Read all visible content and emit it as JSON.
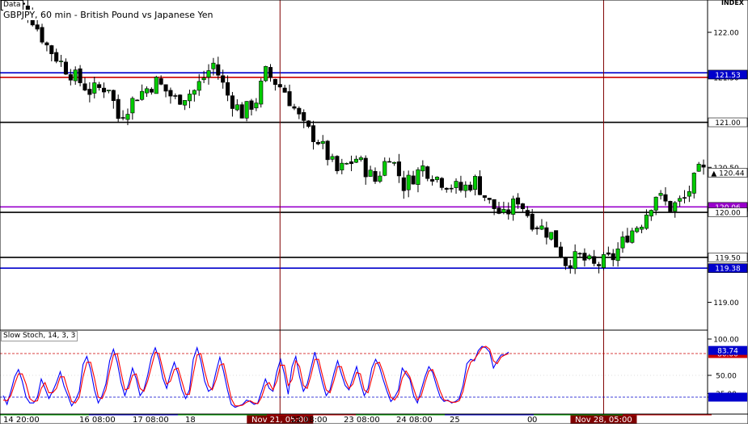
{
  "data_tag": "Data",
  "index_label": "INDEX",
  "chart_data": [
    {
      "type": "candlestick",
      "title": "GBPJPY, 60 min - British Pound vs Japanese Yen",
      "ylim": [
        118.7,
        122.35
      ],
      "y_ticks": [
        "122.00",
        "121.50",
        "121.00",
        "120.50",
        "120.00",
        "119.50",
        "119.00"
      ],
      "horizontal_lines": [
        {
          "value": 121.55,
          "color": "#0000cc"
        },
        {
          "value": 121.5,
          "color": "#cc0000"
        },
        {
          "value": 121.0,
          "color": "#000000"
        },
        {
          "value": 120.06,
          "color": "#9900cc"
        },
        {
          "value": 120.0,
          "color": "#000000"
        },
        {
          "value": 119.5,
          "color": "#000000"
        },
        {
          "value": 119.38,
          "color": "#0000cc"
        }
      ],
      "price_labels": [
        {
          "text": "121.53",
          "value": 121.53,
          "color": "#0000cc"
        },
        {
          "text": "121.00",
          "value": 121.0,
          "color": "#000000"
        },
        {
          "text": "120.44",
          "value": 120.44,
          "color": "#000000",
          "marker": "▲"
        },
        {
          "text": "120.06",
          "value": 120.06,
          "color": "#9900cc"
        },
        {
          "text": "120.00",
          "value": 120.0,
          "color": "#000000"
        },
        {
          "text": "119.50",
          "value": 119.5,
          "color": "#000000"
        },
        {
          "text": "119.38",
          "value": 119.38,
          "color": "#0000cc"
        }
      ],
      "up_color": "#00cc00",
      "down_color": "#000000",
      "close_path": [
        [
          0,
          122.4
        ],
        [
          5,
          122.25
        ],
        [
          9,
          121.85
        ],
        [
          13,
          121.6
        ],
        [
          18,
          121.35
        ],
        [
          22,
          121.4
        ],
        [
          24,
          121.05
        ],
        [
          28,
          121.3
        ],
        [
          32,
          121.45
        ],
        [
          36,
          121.25
        ],
        [
          40,
          121.35
        ],
        [
          44,
          121.65
        ],
        [
          47,
          121.3
        ],
        [
          50,
          121.1
        ],
        [
          53,
          121.25
        ],
        [
          55,
          121.55
        ],
        [
          59,
          121.35
        ],
        [
          63,
          120.95
        ],
        [
          66,
          120.8
        ],
        [
          70,
          120.45
        ],
        [
          74,
          120.6
        ],
        [
          78,
          120.35
        ],
        [
          81,
          120.65
        ],
        [
          84,
          120.3
        ],
        [
          88,
          120.5
        ],
        [
          92,
          120.35
        ],
        [
          96,
          120.25
        ],
        [
          99,
          120.35
        ],
        [
          102,
          120.1
        ],
        [
          105,
          119.95
        ],
        [
          108,
          120.15
        ],
        [
          111,
          119.9
        ],
        [
          115,
          119.75
        ],
        [
          118,
          119.45
        ],
        [
          121,
          119.5
        ],
        [
          124,
          119.4
        ],
        [
          128,
          119.5
        ],
        [
          131,
          119.75
        ],
        [
          134,
          119.9
        ],
        [
          137,
          120.2
        ],
        [
          140,
          120.05
        ],
        [
          143,
          120.15
        ],
        [
          146,
          120.45
        ]
      ],
      "vertical_markers": [
        {
          "label": "Nov 21, 05:00",
          "index": 58,
          "color": "#800000"
        },
        {
          "label": "Nov 28, 05:00",
          "index": 126,
          "color": "#800000"
        }
      ],
      "x_axis_labels": [
        "14 20:00",
        "16 08:00",
        "17 08:00",
        "18",
        "22 08:00",
        "23 08:00",
        "24 08:00",
        "25",
        "0",
        "0"
      ],
      "bars_total": 148
    },
    {
      "type": "line",
      "title": "Slow Stoch, 14, 3, 3",
      "ylim": [
        0,
        100
      ],
      "y_ticks": [
        "100.00",
        "50.00",
        "25.00",
        "20.00"
      ],
      "k_label": "83.74",
      "d_label": "80.00",
      "dashed_levels": [
        {
          "value": 80,
          "color": "#cc0000"
        },
        {
          "value": 20,
          "color": "#0000cc"
        }
      ],
      "series": [
        {
          "color": "#0000ff",
          "values": [
            22,
            10,
            28,
            48,
            58,
            42,
            20,
            12,
            12,
            20,
            45,
            32,
            18,
            28,
            40,
            55,
            35,
            22,
            8,
            16,
            28,
            65,
            76,
            58,
            30,
            12,
            22,
            38,
            70,
            86,
            68,
            40,
            22,
            38,
            60,
            45,
            22,
            30,
            50,
            75,
            88,
            72,
            46,
            32,
            52,
            68,
            52,
            30,
            18,
            30,
            72,
            88,
            70,
            42,
            28,
            32,
            55,
            75,
            55,
            30,
            10,
            6,
            8,
            10,
            16,
            14,
            10,
            12,
            28,
            45,
            32,
            28,
            55,
            72,
            52,
            24,
            62,
            76,
            48,
            28,
            38,
            60,
            82,
            62,
            40,
            22,
            30,
            52,
            70,
            52,
            36,
            30,
            46,
            62,
            40,
            22,
            32,
            60,
            72,
            62,
            44,
            28,
            14,
            20,
            30,
            60,
            52,
            45,
            22,
            12,
            30,
            48,
            62,
            54,
            36,
            20,
            14,
            16,
            12,
            14,
            18,
            36,
            66,
            72,
            70,
            84,
            90,
            88,
            82,
            60,
            70,
            78,
            78,
            82
          ]
        },
        {
          "color": "#ff0000",
          "values": [
            16,
            15,
            22,
            38,
            52,
            52,
            38,
            18,
            14,
            15,
            32,
            40,
            26,
            26,
            32,
            48,
            48,
            30,
            14,
            12,
            20,
            48,
            68,
            68,
            46,
            20,
            18,
            30,
            56,
            78,
            80,
            54,
            30,
            32,
            50,
            52,
            32,
            28,
            42,
            62,
            82,
            80,
            58,
            38,
            42,
            58,
            60,
            42,
            24,
            24,
            52,
            78,
            80,
            56,
            36,
            30,
            44,
            64,
            66,
            42,
            18,
            8,
            8,
            9,
            13,
            15,
            12,
            11,
            20,
            36,
            40,
            30,
            42,
            64,
            64,
            36,
            44,
            70,
            62,
            36,
            32,
            50,
            72,
            72,
            50,
            30,
            26,
            42,
            62,
            62,
            44,
            32,
            38,
            54,
            52,
            30,
            26,
            46,
            66,
            68,
            54,
            36,
            20,
            16,
            24,
            46,
            56,
            48,
            32,
            16,
            22,
            40,
            56,
            58,
            44,
            28,
            16,
            15,
            13,
            13,
            15,
            28,
            52,
            68,
            72,
            80,
            88,
            90,
            86,
            70,
            66,
            75,
            78,
            80
          ]
        }
      ]
    }
  ]
}
